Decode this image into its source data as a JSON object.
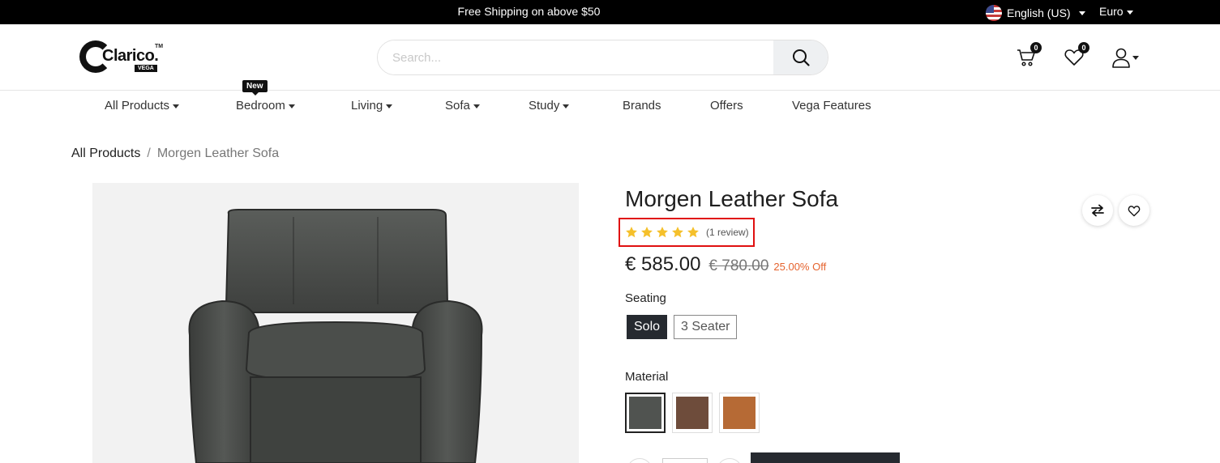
{
  "topbar": {
    "shipping_text": "Free Shipping on above $50",
    "language": "English (US)",
    "currency": "Euro"
  },
  "header": {
    "logo_text": "Clarico.",
    "logo_tm": "TM",
    "logo_sub": "VEGA",
    "search_placeholder": "Search...",
    "cart_count": "0",
    "wishlist_count": "0"
  },
  "nav": {
    "new_tag": "New",
    "items": [
      {
        "label": "All Products"
      },
      {
        "label": "Bedroom"
      },
      {
        "label": "Living"
      },
      {
        "label": "Sofa"
      },
      {
        "label": "Study"
      },
      {
        "label": "Brands"
      },
      {
        "label": "Offers"
      },
      {
        "label": "Vega Features"
      }
    ]
  },
  "breadcrumb": {
    "parent": "All Products",
    "separator": "/",
    "current": "Morgen Leather Sofa"
  },
  "product": {
    "title": "Morgen Leather Sofa",
    "rating_stars": 5,
    "review_text": "(1 review)",
    "price": "€ 585.00",
    "old_price": "€ 780.00",
    "discount": "25.00% Off",
    "seating_label": "Seating",
    "seating_options": [
      "Solo",
      "3 Seater"
    ],
    "material_label": "Material",
    "materials": [
      {
        "name": "grey-leather",
        "color": "#505350"
      },
      {
        "name": "brown-leather",
        "color": "#6e4c3b"
      },
      {
        "name": "tan-leather",
        "color": "#b66a35"
      }
    ]
  },
  "colors": {
    "accent": "#262a30",
    "star": "#f5c02b",
    "discount": "#e5632e",
    "highlight": "#e01010"
  }
}
